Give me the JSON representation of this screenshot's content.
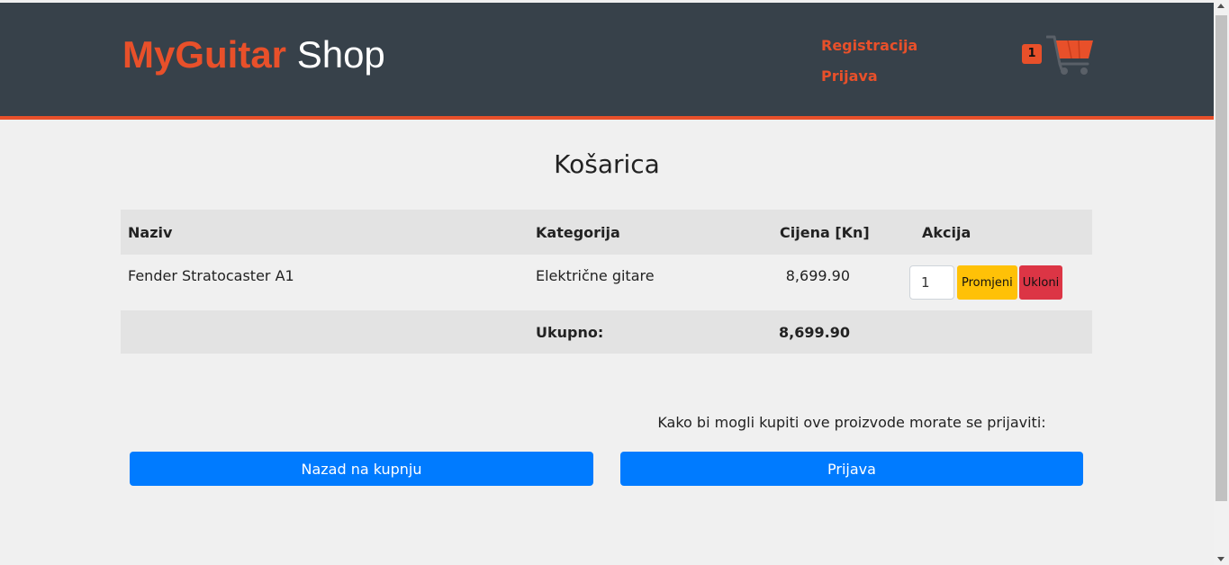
{
  "header": {
    "brand": "MyGuitar",
    "brand_suffix": "Shop",
    "nav": {
      "register": "Registracija",
      "login": "Prijava"
    },
    "cart_count": "1",
    "accent_color": "#e8502a",
    "background_color": "#37414a"
  },
  "main": {
    "title": "Košarica",
    "table": {
      "columns": [
        "Naziv",
        "Kategorija",
        "Cijena [Kn]",
        "Akcija"
      ],
      "rows": [
        {
          "name": "Fender Stratocaster A1",
          "category": "Električne gitare",
          "price": "8,699.90",
          "quantity": "1",
          "update_label": "Promjeni",
          "remove_label": "Ukloni"
        }
      ],
      "total_label": "Ukupno:",
      "total_value": "8,699.90"
    },
    "login_note": "Kako bi mogli kupiti ove proizvode morate se prijaviti:",
    "back_button": "Nazad na kupnju",
    "login_button": "Prijava"
  },
  "icons": [
    "cart-icon"
  ],
  "colors": {
    "primary": "#007bff",
    "warning": "#ffc107",
    "danger": "#dc3545"
  }
}
